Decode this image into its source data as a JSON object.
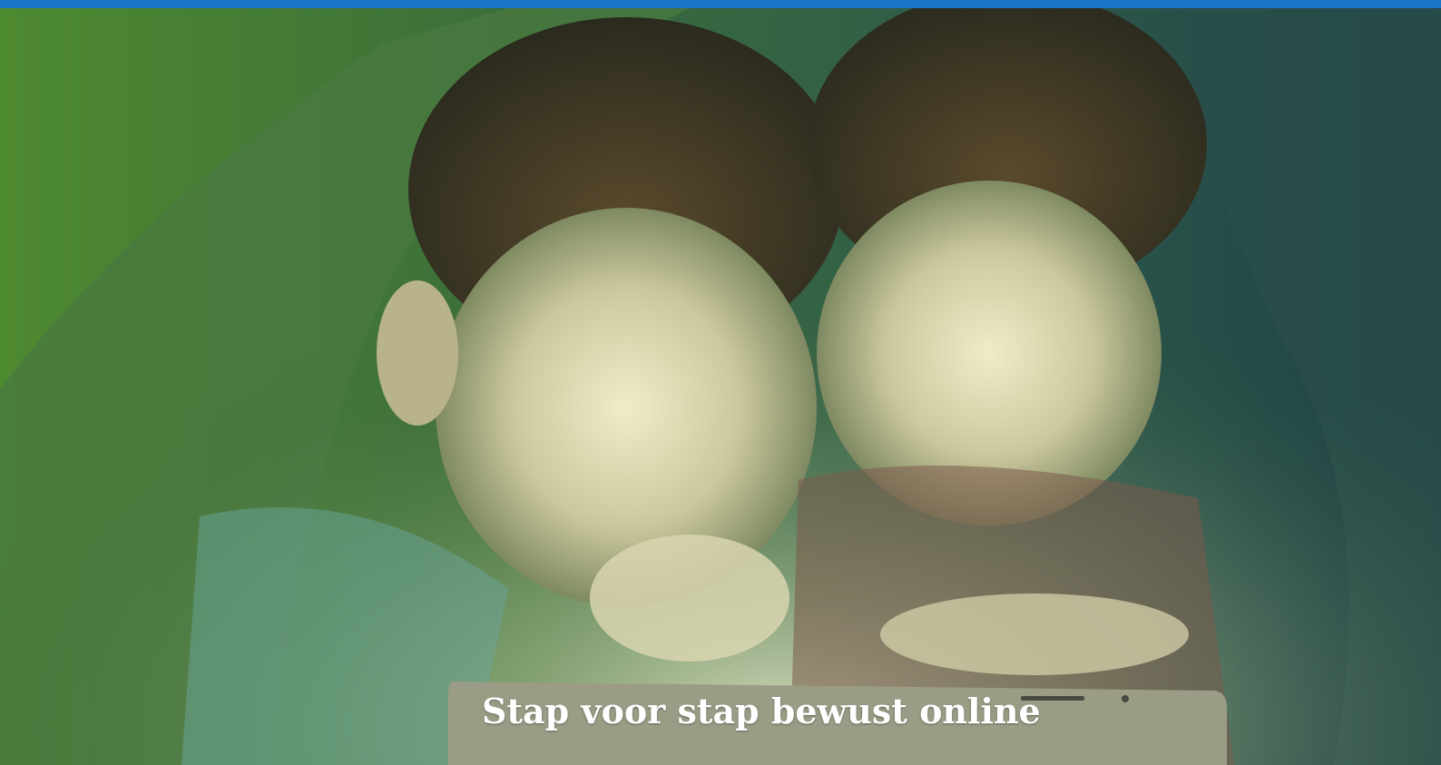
{
  "hero": {
    "title": "Stap voor stap bewust online",
    "image_description_icon": "children-with-tablet-photo"
  },
  "colors": {
    "topbar": "#1a73c9",
    "overlay_left": "#4f8a2e",
    "overlay_right": "#1c4a4a",
    "title_text": "#ffffff"
  }
}
